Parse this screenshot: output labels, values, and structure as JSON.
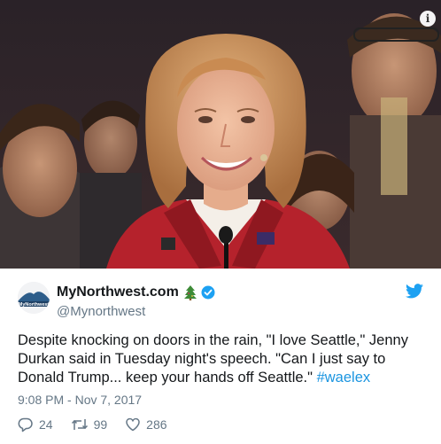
{
  "photo": {
    "info_icon": "info-icon"
  },
  "tweet": {
    "avatar_text": "MyNorthwest",
    "display_name": "MyNorthwest.com",
    "emoji_icon": "tree-icon",
    "verified_icon": "verified-badge-icon",
    "handle": "@Mynorthwest",
    "logo_icon": "twitter-bird-icon",
    "text": "Despite knocking on doors in the rain, \"I love Seattle,\" Jenny Durkan said in Tuesday night's speech. \"Can I just say to Donald Trump... keep your hands off Seattle.\" ",
    "hashtag": "#waelex",
    "timestamp": "9:08 PM - Nov 7, 2017",
    "replies": "24",
    "retweets": "99",
    "likes": "286"
  },
  "colors": {
    "accent": "#1b95e0",
    "secondary_text": "#657786",
    "primary_text": "#14171a",
    "verified": "#1da1f2",
    "jacket": "#b5222c"
  }
}
